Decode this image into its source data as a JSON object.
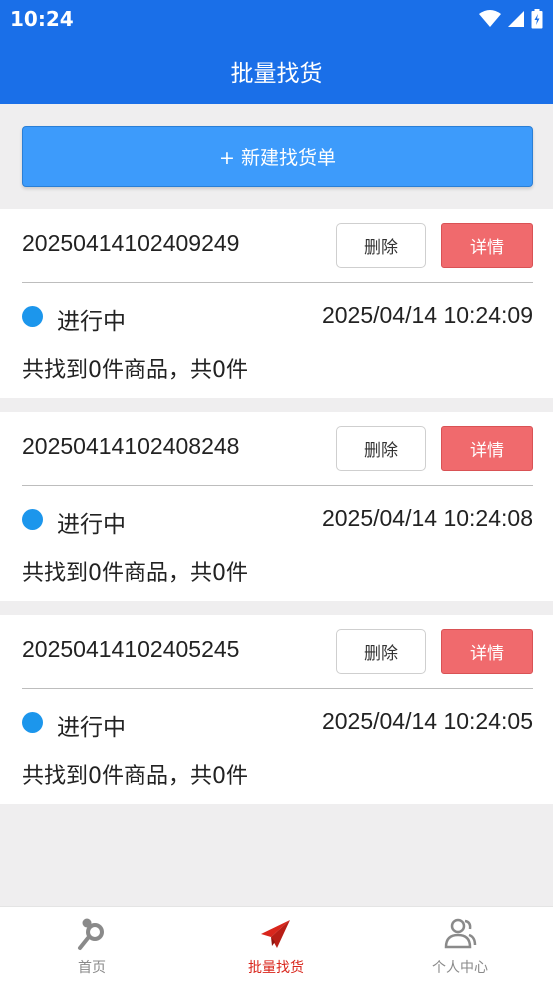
{
  "status_bar": {
    "time": "10:24"
  },
  "header": {
    "title": "批量找货"
  },
  "new_button": {
    "label": "+ 新建找货单"
  },
  "orders": [
    {
      "id": "20250414102409249",
      "delete_label": "删除",
      "detail_label": "详情",
      "status": "进行中",
      "time": "2025/04/14 10:24:09",
      "summary": "共找到0件商品，共0件"
    },
    {
      "id": "20250414102408248",
      "delete_label": "删除",
      "detail_label": "详情",
      "status": "进行中",
      "time": "2025/04/14 10:24:08",
      "summary": "共找到0件商品，共0件"
    },
    {
      "id": "20250414102405245",
      "delete_label": "删除",
      "detail_label": "详情",
      "status": "进行中",
      "time": "2025/04/14 10:24:05",
      "summary": "共找到0件商品，共0件"
    }
  ],
  "tabs": [
    {
      "label": "首页",
      "icon": "search-magnifier-icon",
      "active": false
    },
    {
      "label": "批量找货",
      "icon": "paper-plane-icon",
      "active": true
    },
    {
      "label": "个人中心",
      "icon": "users-icon",
      "active": false
    }
  ],
  "colors": {
    "primary": "#1a6fe8",
    "button_blue": "#3d9bfb",
    "detail_red": "#f06a6d",
    "status_dot": "#1c96ec",
    "tab_active": "#d9261c",
    "tab_inactive": "#8a8a8a"
  }
}
